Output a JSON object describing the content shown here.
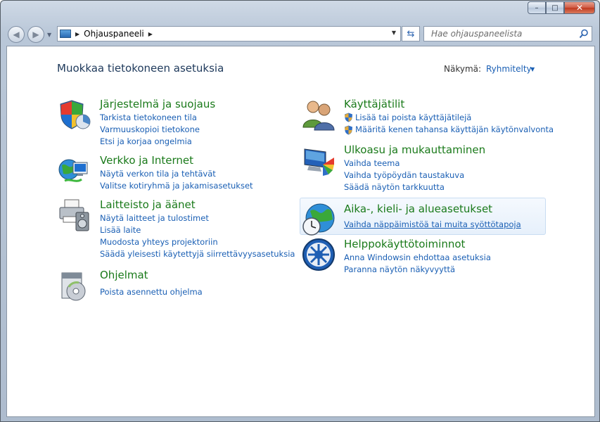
{
  "window": {
    "caption_buttons": {
      "minimize": "–",
      "maximize": "□",
      "close": "✕"
    }
  },
  "navigation": {
    "back_glyph": "◀",
    "forward_glyph": "▶",
    "recent_glyph": "▼",
    "breadcrumb_sep": "▶",
    "breadcrumb_root": "Ohjauspaneeli",
    "breadcrumb_end_sep": "▶",
    "dropdown_glyph": "▼",
    "refresh_glyph": "⇆",
    "search_placeholder": "Hae ohjauspaneelista",
    "search_icon": "search-icon"
  },
  "header": {
    "title": "Muokkaa tietokoneen asetuksia",
    "view_label": "Näkymä:",
    "view_value": "Ryhmitelty",
    "view_arrow": "▼"
  },
  "categories_left": [
    {
      "title": "Järjestelmä ja suojaus",
      "icon": "shield-system-icon",
      "links": [
        "Tarkista tietokoneen tila",
        "Varmuuskopioi tietokone",
        "Etsi ja korjaa ongelmia"
      ]
    },
    {
      "title": "Verkko ja Internet",
      "icon": "network-globe-icon",
      "links": [
        "Näytä verkon tila ja tehtävät",
        "Valitse kotiryhmä ja jakamisasetukset"
      ]
    },
    {
      "title": "Laitteisto ja äänet",
      "icon": "printer-speaker-icon",
      "links": [
        "Näytä laitteet ja tulostimet",
        "Lisää laite",
        "Muodosta yhteys projektoriin",
        "Säädä yleisesti käytettyjä siirrettävyysasetuksia"
      ]
    },
    {
      "title": "Ohjelmat",
      "icon": "programs-disc-icon",
      "links": [
        "Poista asennettu ohjelma"
      ]
    }
  ],
  "categories_right": [
    {
      "title": "Käyttäjätilit",
      "icon": "users-icon",
      "links": [
        "Lisää tai poista käyttäjätilejä",
        "Määritä kenen tahansa käyttäjän käytönvalvonta"
      ]
    },
    {
      "title": "Ulkoasu ja mukauttaminen",
      "icon": "monitor-palette-icon",
      "links": [
        "Vaihda teema",
        "Vaihda työpöydän taustakuva",
        "Säädä näytön tarkkuutta"
      ]
    },
    {
      "title": "Aika-, kieli- ja alueasetukset",
      "icon": "clock-globe-icon",
      "links": [
        "Vaihda näppäimistöä tai muita syöttötapoja"
      ]
    },
    {
      "title": "Helppokäyttötoiminnot",
      "icon": "ease-of-access-icon",
      "links": [
        "Anna Windowsin ehdottaa asetuksia",
        "Paranna näytön näkyvyyttä"
      ]
    }
  ],
  "colors": {
    "link": "#1a5fb4",
    "category_title": "#1a7a1a",
    "page_title": "#1e395b",
    "highlight_border": "#c8dcf2"
  }
}
